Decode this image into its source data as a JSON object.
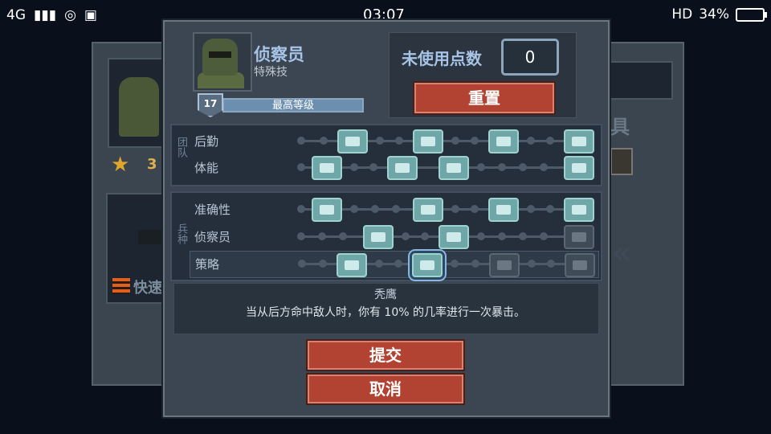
{
  "status_bar": {
    "network": "4G",
    "time": "03:07",
    "hd": "HD",
    "battery": "34%"
  },
  "background": {
    "star_count": "3",
    "gear_label_fragment": "具",
    "weapon_label_fragment": "快速"
  },
  "dialog": {
    "unit_name": "侦察员",
    "unit_subtitle": "特殊技",
    "level": "17",
    "level_label": "最高等级",
    "points_label": "未使用点数",
    "points_value": "0",
    "reset_label": "重置",
    "team_tag": "团队",
    "class_tag": "兵种",
    "skill_rows": [
      {
        "label": "后勤"
      },
      {
        "label": "体能"
      },
      {
        "label": "准确性"
      },
      {
        "label": "侦察员"
      },
      {
        "label": "策略"
      }
    ],
    "selected_skill_title": "秃鹰",
    "selected_skill_desc": "当从后方命中敌人时，你有 10% 的几率进行一次暴击。",
    "submit_label": "提交",
    "cancel_label": "取消"
  },
  "colors": {
    "accent_button": "#b24332",
    "skill_active": "#6fa6a8",
    "label_blue": "#a7c4e6"
  }
}
